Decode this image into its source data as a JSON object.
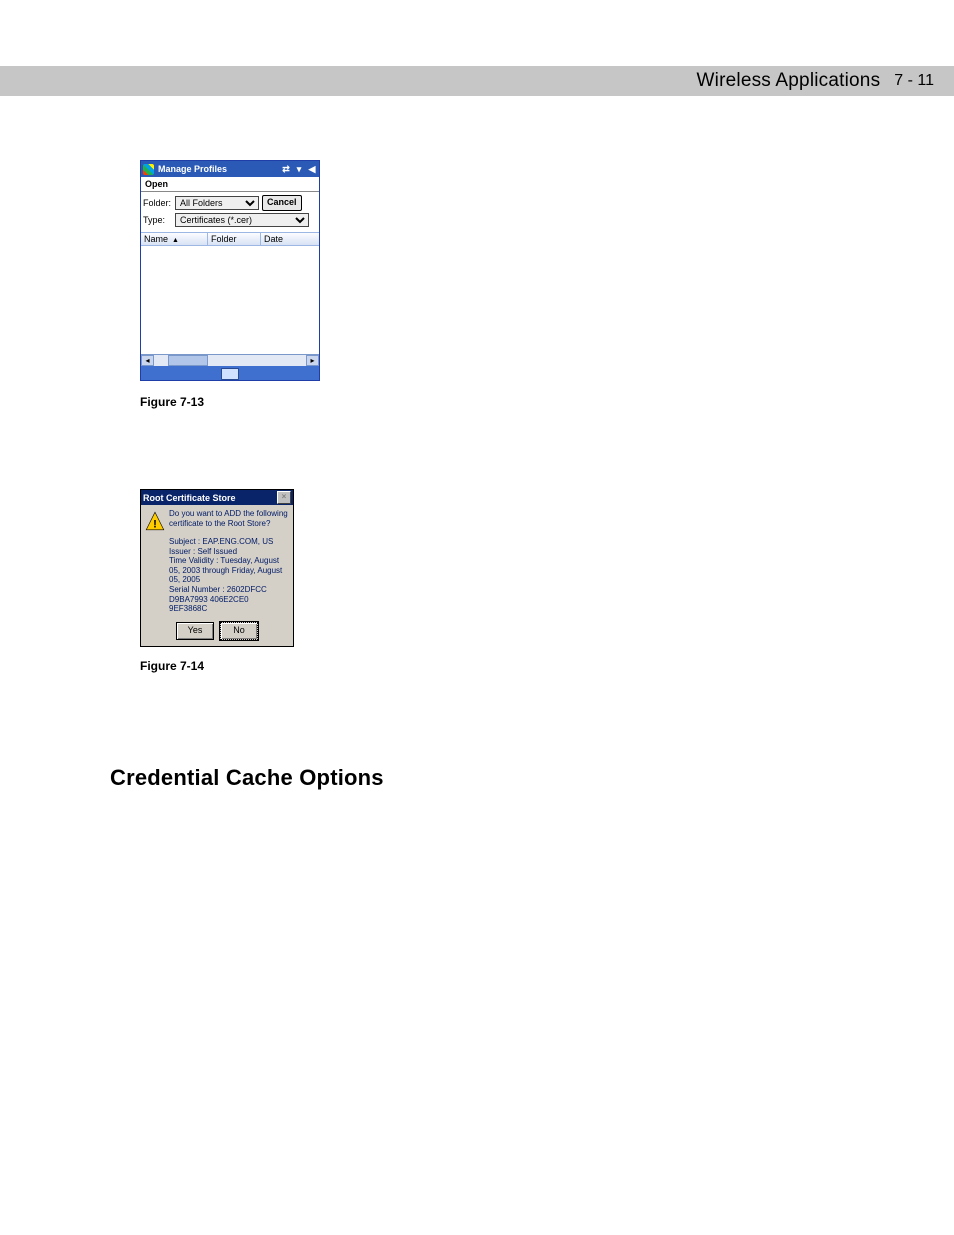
{
  "header": {
    "title": "Wireless Applications",
    "page_number": "7 - 11"
  },
  "figure713": {
    "titlebar": "Manage Profiles",
    "open_label": "Open",
    "folder_label": "Folder:",
    "folder_value": "All Folders",
    "type_label": "Type:",
    "type_value": "Certificates (*.cer)",
    "cancel_button": "Cancel",
    "col_name": "Name",
    "col_folder": "Folder",
    "col_date": "Date",
    "caption": "Figure 7-13"
  },
  "figure714": {
    "titlebar": "Root Certificate Store",
    "question": "Do you want to ADD the following certificate to the Root Store?",
    "subject": "Subject : EAP.ENG.COM, US",
    "issuer": "Issuer : Self Issued",
    "validity": "Time Validity : Tuesday, August 05, 2003 through Friday, August 05, 2005",
    "serial": "Serial Number : 2602DFCC D9BA7993 406E2CE0 9EF3868C",
    "yes": "Yes",
    "no": "No",
    "caption": "Figure 7-14"
  },
  "section_heading": "Credential Cache Options"
}
